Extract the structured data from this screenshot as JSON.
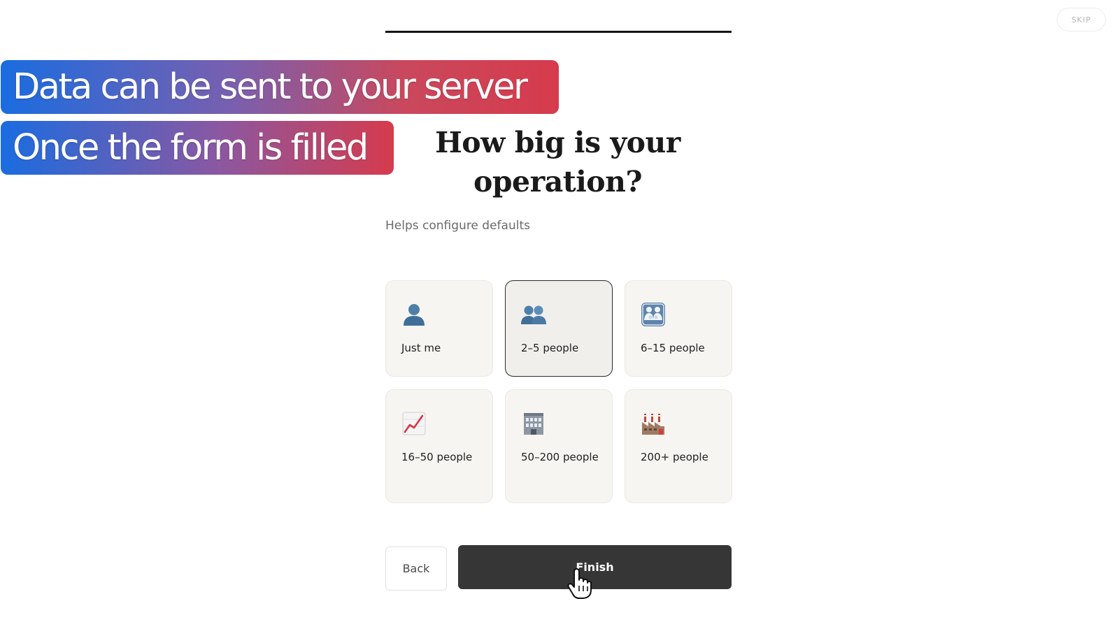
{
  "header": {
    "skip_label": "SKIP",
    "progress_fraction": 1.0
  },
  "overlay": {
    "banner_1": "Data can be sent to your server",
    "banner_2": "Once the form is filled"
  },
  "question": {
    "title_line_1": "How big is your",
    "title_line_2": "operation?",
    "subtitle": "Helps configure defaults"
  },
  "options": [
    {
      "label": "Just me",
      "icon": "bust-icon",
      "selected": false
    },
    {
      "label": "2–5 people",
      "icon": "two-busts-icon",
      "selected": true
    },
    {
      "label": "6–15 people",
      "icon": "family-icon",
      "selected": false
    },
    {
      "label": "16–50 people",
      "icon": "chart-increasing-icon",
      "selected": false
    },
    {
      "label": "50–200 people",
      "icon": "office-building-icon",
      "selected": false
    },
    {
      "label": "200+ people",
      "icon": "factory-icon",
      "selected": false
    }
  ],
  "actions": {
    "back_label": "Back",
    "finish_label": "Finish"
  },
  "colors": {
    "finish_bg": "#363636",
    "card_bg": "#f7f5f2",
    "banner_blue": "#1a6ce0",
    "banner_red": "#d63b4c"
  }
}
